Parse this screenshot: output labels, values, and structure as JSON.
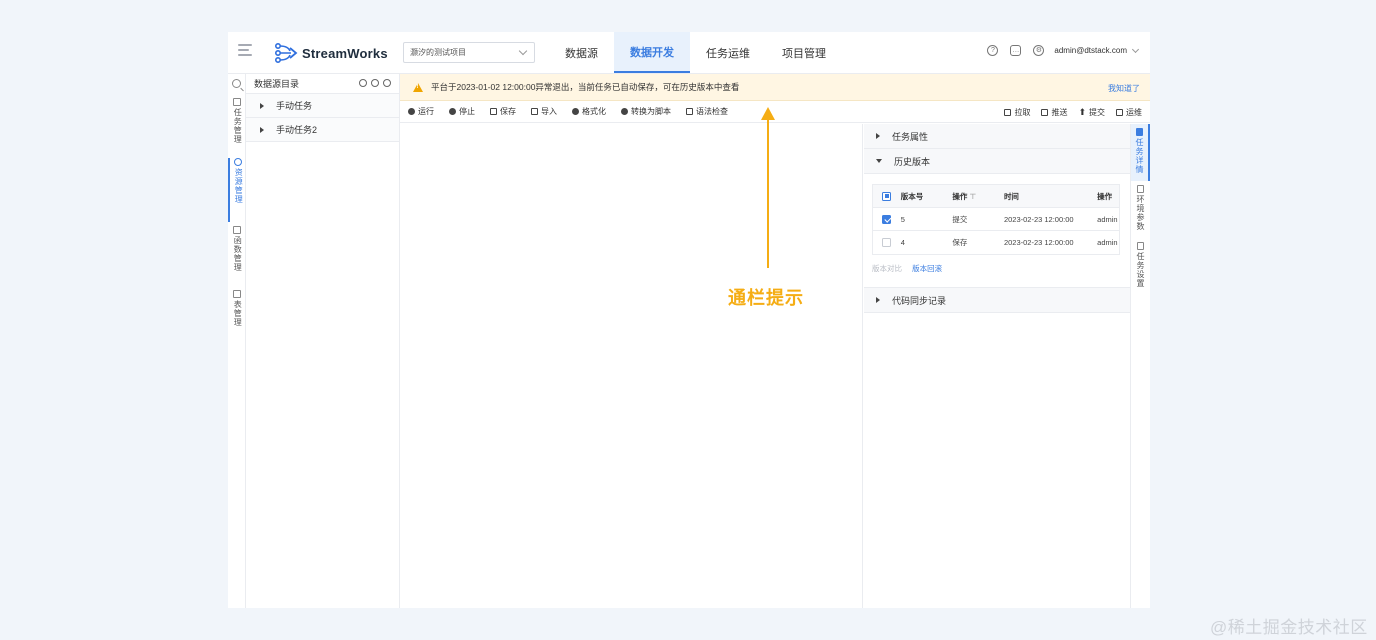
{
  "header": {
    "brand": "StreamWorks",
    "project": "灏汐的测试项目",
    "nav_tabs": [
      {
        "label": "数据源"
      },
      {
        "label": "数据开发"
      },
      {
        "label": "任务运维"
      },
      {
        "label": "项目管理"
      }
    ],
    "user": "admin@dtstack.com",
    "icons": [
      "help-icon",
      "message-icon",
      "settings-icon"
    ]
  },
  "left_nav": {
    "items": [
      {
        "label": "任务管理",
        "icon": "task-icon"
      },
      {
        "label": "资源管理",
        "icon": "resource-icon"
      },
      {
        "label": "函数管理",
        "icon": "function-icon"
      },
      {
        "label": "表管理",
        "icon": "table-icon"
      }
    ]
  },
  "tree": {
    "title": "数据源目录",
    "nodes": [
      {
        "label": "手动任务"
      },
      {
        "label": "手动任务2"
      }
    ]
  },
  "alert": {
    "message": "平台于2023-01-02 12:00:00异常退出，当前任务已自动保存，可在历史版本中查看",
    "action": "我知道了"
  },
  "toolbar": {
    "left": [
      {
        "label": "运行"
      },
      {
        "label": "停止"
      },
      {
        "label": "保存"
      },
      {
        "label": "导入"
      },
      {
        "label": "格式化"
      },
      {
        "label": "转换为脚本"
      },
      {
        "label": "语法检查"
      }
    ],
    "right": [
      {
        "label": "拉取"
      },
      {
        "label": "推送"
      },
      {
        "label": "提交"
      },
      {
        "label": "运维"
      }
    ]
  },
  "right_panel": {
    "sections": {
      "properties": "任务属性",
      "history": "历史版本",
      "sync": "代码同步记录"
    },
    "version_table": {
      "columns": [
        "版本号",
        "操作",
        "时间",
        "操作"
      ],
      "rows": [
        {
          "version": "5",
          "op": "提交",
          "time": "2023-02-23 12:00:00",
          "user": "admin",
          "checked": true
        },
        {
          "version": "4",
          "op": "保存",
          "time": "2023-02-23 12:00:00",
          "user": "admin",
          "checked": false
        }
      ]
    },
    "actions": {
      "compare": "版本对比",
      "rollback": "版本回滚"
    }
  },
  "right_tabs": [
    {
      "label": "任务详情"
    },
    {
      "label": "环境参数"
    },
    {
      "label": "任务设置"
    }
  ],
  "annotation": "通栏提示",
  "watermark": "@稀土掘金技术社区",
  "colors": {
    "accent": "#3b7de0",
    "annotation": "#f5ad14",
    "alert_bg": "#fff6e3"
  }
}
